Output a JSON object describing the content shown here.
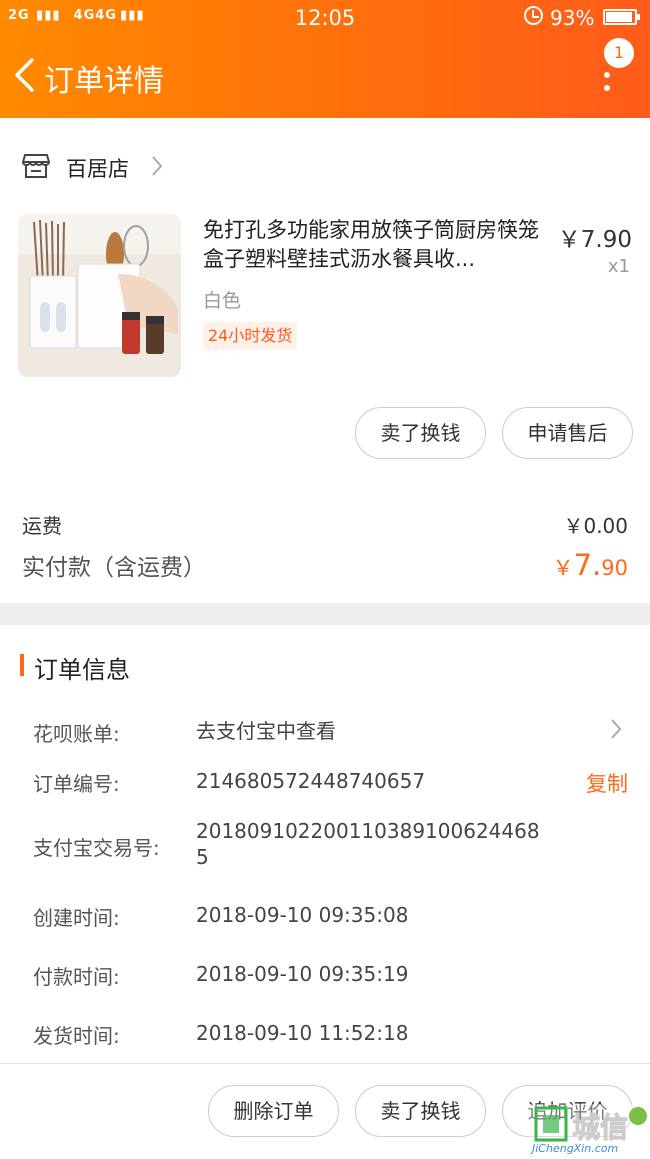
{
  "status_bar": {
    "signal": "2G  ▮▮▮  4G4G ▮▮▮",
    "time": "12:05",
    "battery": "93%",
    "battery_level": 0.93
  },
  "header": {
    "title": "订单详情",
    "notification_count": "1"
  },
  "shop": {
    "name": "百居店"
  },
  "product": {
    "title": "免打孔多功能家用放筷子筒厨房筷笼盒子塑料壁挂式沥水餐具收...",
    "sku": "白色",
    "tag": "24小时发货",
    "price": "￥7.90",
    "qty": "x1"
  },
  "item_actions": {
    "sell_label": "卖了换钱",
    "aftersale_label": "申请售后"
  },
  "fees": {
    "shipping_label": "运费",
    "shipping_value": "￥0.00",
    "paid_label": "实付款（含运费）",
    "paid_currency": "￥",
    "paid_int": "7.",
    "paid_dec": "90"
  },
  "order_info": {
    "title": "订单信息",
    "huabei_label": "花呗账单:",
    "huabei_value": "去支付宝中查看",
    "order_no_label": "订单编号:",
    "order_no_value": "214680572448740657",
    "copy_label": "复制",
    "alipay_no_label": "支付宝交易号:",
    "alipay_no_value": "2018091022001103891006244685",
    "created_label": "创建时间:",
    "created_value": "2018-09-10 09:35:08",
    "paid_label": "付款时间:",
    "paid_value": "2018-09-10 09:35:19",
    "shipped_label": "发货时间:",
    "shipped_value": "2018-09-10 11:52:18"
  },
  "footer": {
    "delete_label": "删除订单",
    "sell_label": "卖了换钱",
    "review_label": "追加评价"
  },
  "watermark": {
    "brand": "城信",
    "url": "JiChengXin.com"
  },
  "colors": {
    "accent": "#ff6a1a",
    "header_start": "#ff8a00",
    "header_end": "#ff5b1a"
  }
}
